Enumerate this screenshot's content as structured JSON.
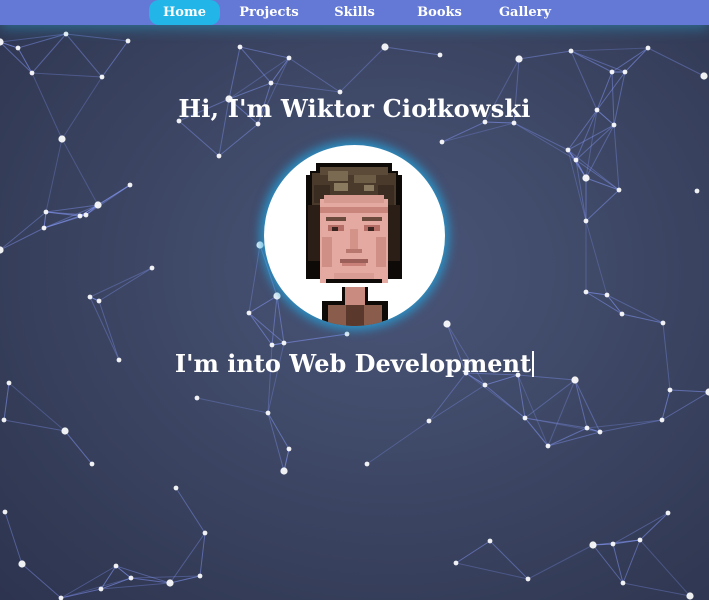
{
  "nav": {
    "items": [
      {
        "label": "Home",
        "active": true
      },
      {
        "label": "Projects",
        "active": false
      },
      {
        "label": "Skills",
        "active": false
      },
      {
        "label": "Books",
        "active": false
      },
      {
        "label": "Gallery",
        "active": false
      }
    ]
  },
  "hero": {
    "greeting": "Hi, I'm Wiktor Ciołkowski",
    "typed_text": "I'm into Web Development"
  },
  "colors": {
    "navbar": "#6479d6",
    "nav_active": "#22b5e8",
    "background": "#3d4765",
    "particle_line": "#8a9cff",
    "particle_dot": "#ffffff",
    "avatar_glow": "#22aae6"
  },
  "icons": {
    "avatar": "pixel-art-portrait"
  }
}
